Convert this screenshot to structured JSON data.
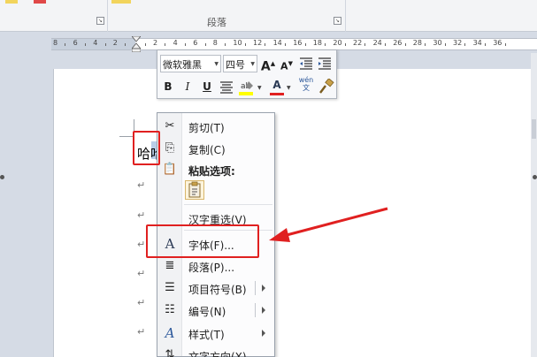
{
  "ribbon": {
    "group_label": "段落"
  },
  "ruler": {
    "numbers": [
      "8",
      "6",
      "4",
      "2",
      "",
      "2",
      "4",
      "6",
      "8",
      "10",
      "12",
      "14",
      "16",
      "18",
      "20",
      "22",
      "24",
      "26",
      "28",
      "30",
      "32",
      "34",
      "36"
    ]
  },
  "document": {
    "selected_text": "哈哈",
    "para_mark": "↵"
  },
  "mini_toolbar": {
    "font_name": "微软雅黑",
    "font_size": "四号",
    "grow_font": "A",
    "shrink_font": "A",
    "bold": "B",
    "italic": "I",
    "underline": "U",
    "font_color": "A",
    "phonetic": "wén\n文"
  },
  "context_menu": {
    "cut": "剪切(T)",
    "copy": "复制(C)",
    "paste_options": "粘贴选项:",
    "hanzi_reselect": "汉字重选(V)",
    "font": "字体(F)...",
    "paragraph": "段落(P)...",
    "bullets": "项目符号(B)",
    "numbering": "编号(N)",
    "styles": "样式(T)",
    "more": "文字方向(X)..."
  },
  "colors": {
    "annotation": "#e02020",
    "accent": "#2b579a"
  }
}
